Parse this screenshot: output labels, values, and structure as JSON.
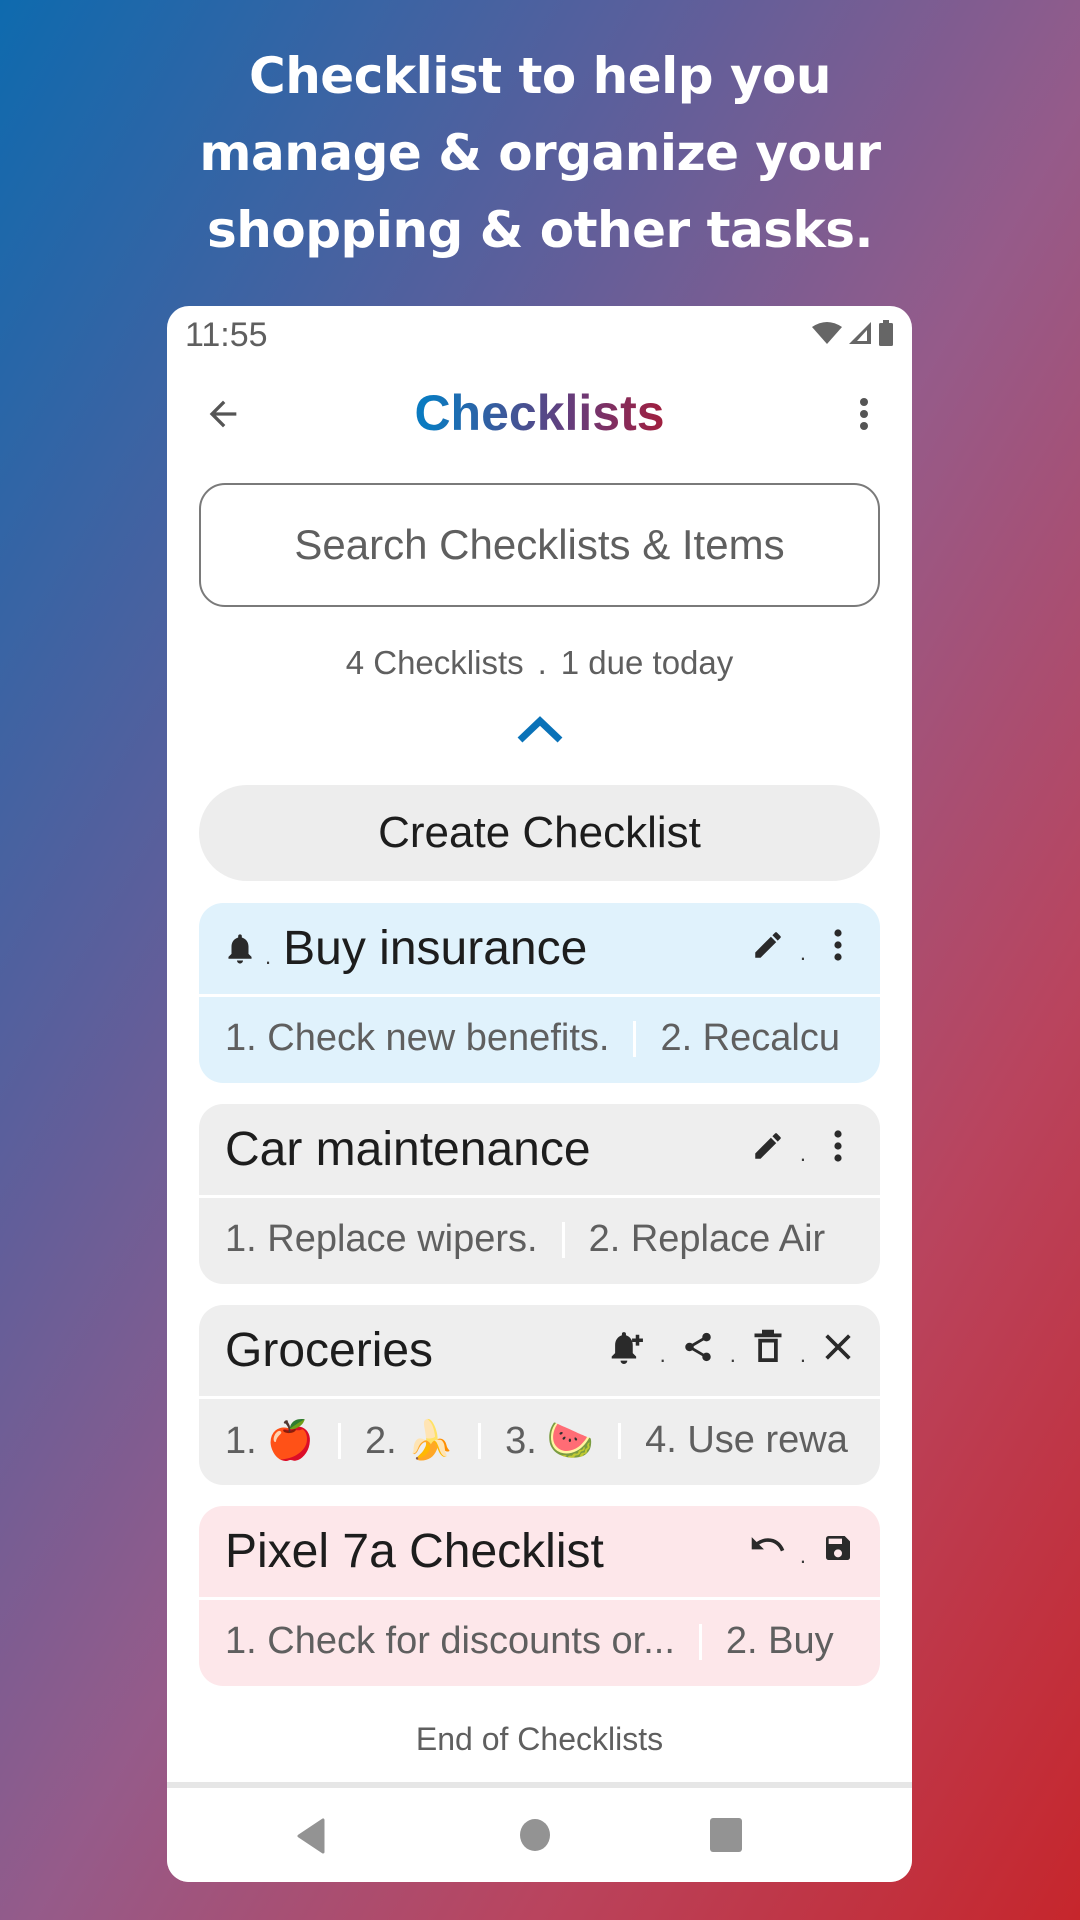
{
  "headline": {
    "lines": [
      "Checklist to help you",
      "manage & organize your",
      "shopping & other tasks."
    ]
  },
  "status_bar": {
    "time": "11:55",
    "icons": [
      "wifi-icon",
      "signal-icon",
      "battery-icon"
    ]
  },
  "app_bar": {
    "title": "Checklists",
    "title_gradient": [
      "#0075be",
      "#c41e2e"
    ],
    "back_icon": "arrow-left-icon",
    "menu_icon": "more-vertical-icon"
  },
  "search": {
    "placeholder": "Search Checklists & Items",
    "value": ""
  },
  "summary": {
    "count_label": "4 Checklists",
    "separator": ".",
    "due_label": "1 due today"
  },
  "collapse_icon": "chevron-up-icon",
  "accent_color": "#0a72b8",
  "create_button_label": "Create Checklist",
  "checklists": [
    {
      "title": "Buy insurance",
      "color": "#e0f2fc",
      "leading_icon": "bell-icon",
      "actions": [
        "edit-icon",
        "more-vertical-icon"
      ],
      "items": [
        "1. Check new benefits.",
        "2. Recalcu"
      ]
    },
    {
      "title": "Car maintenance",
      "color": "#eeeeee",
      "actions": [
        "edit-icon",
        "more-vertical-icon"
      ],
      "items": [
        "1. Replace wipers.",
        "2. Replace Air"
      ]
    },
    {
      "title": "Groceries",
      "color": "#eeeeee",
      "actions": [
        "bell-plus-icon",
        "share-icon",
        "trash-icon",
        "close-icon"
      ],
      "items": [
        {
          "label": "1.",
          "emoji": "🍎"
        },
        {
          "label": "2.",
          "emoji": "🍌"
        },
        {
          "label": "3.",
          "emoji": "🍉"
        },
        {
          "label": "4. Use rewa",
          "emoji": ""
        }
      ]
    },
    {
      "title": "Pixel 7a Checklist",
      "color": "#fde7ea",
      "actions": [
        "undo-icon",
        "save-icon"
      ],
      "items": [
        "1. Check for discounts or...",
        "2. Buy"
      ]
    }
  ],
  "end_text": "End of Checklists",
  "nav_bar": {
    "buttons": [
      "back-nav-icon",
      "home-nav-icon",
      "recents-nav-icon"
    ]
  }
}
